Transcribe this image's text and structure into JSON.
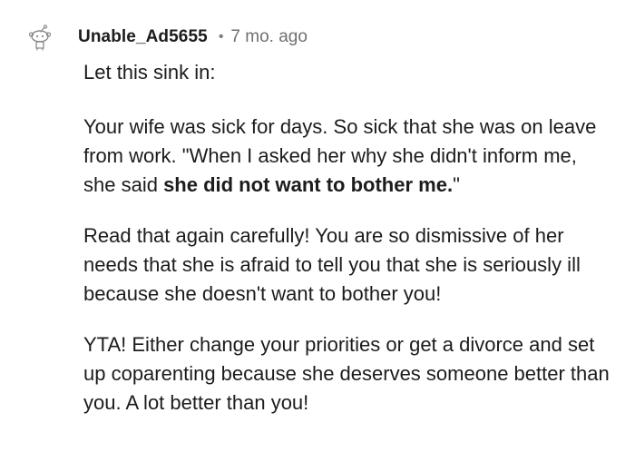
{
  "comment": {
    "avatar_icon": "snoo-avatar-icon",
    "username": "Unable_Ad5655",
    "separator": "•",
    "age": "7 mo. ago",
    "paragraphs": {
      "p1": "Let this sink in:",
      "p2_a": "Your wife was sick for days. So sick that she was on leave from work. \"When I asked her why she didn't inform me, she said ",
      "p2_bold": "she did not want to bother me.",
      "p2_end": "\"",
      "p3": "Read that again carefully! You are so dismissive of her needs that she is afraid to tell you that she is seriously ill because she doesn't want to bother you!",
      "p4": "YTA! Either change your priorities or get a divorce and set up coparenting because she deserves someone better than you. A lot better than you!"
    }
  }
}
